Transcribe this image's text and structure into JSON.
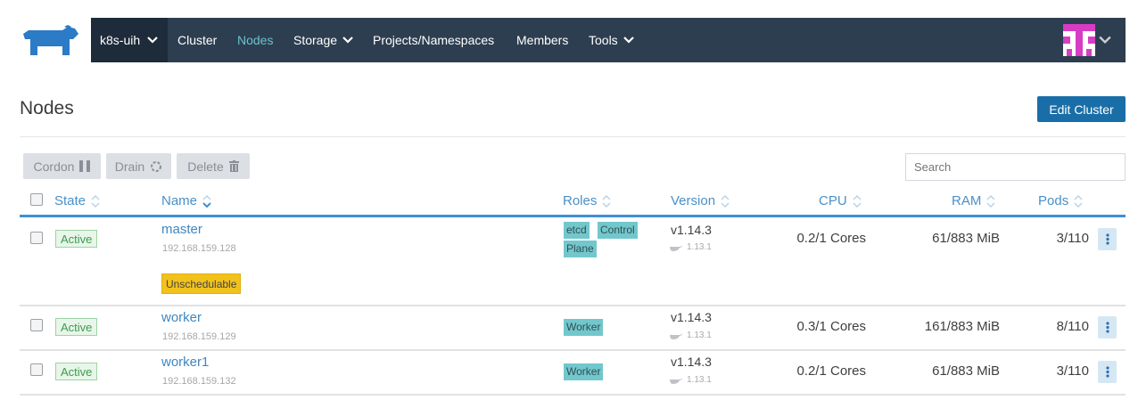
{
  "header": {
    "cluster_name": "k8s-uih",
    "nav": [
      {
        "label": "Cluster",
        "active": false
      },
      {
        "label": "Nodes",
        "active": true
      },
      {
        "label": "Storage",
        "active": false
      },
      {
        "label": "Projects/Namespaces",
        "active": false
      },
      {
        "label": "Members",
        "active": false
      },
      {
        "label": "Tools",
        "active": false
      }
    ]
  },
  "page": {
    "title": "Nodes",
    "edit_button": "Edit Cluster"
  },
  "toolbar": {
    "cordon": "Cordon",
    "drain": "Drain",
    "delete": "Delete",
    "search_placeholder": "Search"
  },
  "table": {
    "columns": {
      "state": "State",
      "name": "Name",
      "roles": "Roles",
      "version": "Version",
      "cpu": "CPU",
      "ram": "RAM",
      "pods": "Pods"
    },
    "rows": [
      {
        "state": "Active",
        "name": "master",
        "ip": "192.168.159.128",
        "tag": "Unschedulable",
        "roles": [
          "etcd",
          "Control",
          "Plane"
        ],
        "version": "v1.14.3",
        "docker": "1.13.1",
        "cpu": "0.2/1 Cores",
        "ram": "61/883 MiB",
        "pods": "3/110"
      },
      {
        "state": "Active",
        "name": "worker",
        "ip": "192.168.159.129",
        "roles": [
          "Worker"
        ],
        "version": "v1.14.3",
        "docker": "1.13.1",
        "cpu": "0.3/1 Cores",
        "ram": "161/883 MiB",
        "pods": "8/110"
      },
      {
        "state": "Active",
        "name": "worker1",
        "ip": "192.168.159.132",
        "roles": [
          "Worker"
        ],
        "version": "v1.14.3",
        "docker": "1.13.1",
        "cpu": "0.2/1 Cores",
        "ram": "61/883 MiB",
        "pods": "3/110"
      }
    ]
  },
  "colors": {
    "navbar": "#2d3e50",
    "accent": "#3f8fd2",
    "role_badge": "#72c7cc",
    "active_badge": "#3c9c4c",
    "unschedulable": "#f2c21c"
  },
  "icons": [
    "rancher-logo-icon",
    "chevron-down-icon",
    "avatar-icon",
    "pause-icon",
    "refresh-icon",
    "trash-icon",
    "sort-icon",
    "docker-icon",
    "kebab-menu-icon"
  ]
}
